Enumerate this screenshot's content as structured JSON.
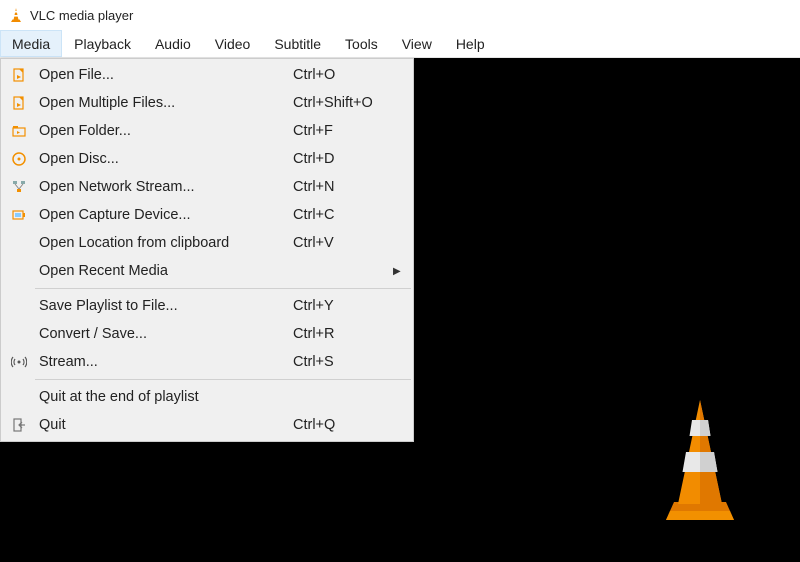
{
  "window": {
    "title": "VLC media player"
  },
  "menubar": [
    {
      "label": "Media",
      "active": true
    },
    {
      "label": "Playback"
    },
    {
      "label": "Audio"
    },
    {
      "label": "Video"
    },
    {
      "label": "Subtitle"
    },
    {
      "label": "Tools"
    },
    {
      "label": "View"
    },
    {
      "label": "Help"
    }
  ],
  "media_menu": {
    "groups": [
      [
        {
          "icon": "file-icon",
          "label": "Open File...",
          "shortcut": "Ctrl+O"
        },
        {
          "icon": "file-icon",
          "label": "Open Multiple Files...",
          "shortcut": "Ctrl+Shift+O"
        },
        {
          "icon": "folder-icon",
          "label": "Open Folder...",
          "shortcut": "Ctrl+F"
        },
        {
          "icon": "disc-icon",
          "label": "Open Disc...",
          "shortcut": "Ctrl+D"
        },
        {
          "icon": "network-icon",
          "label": "Open Network Stream...",
          "shortcut": "Ctrl+N"
        },
        {
          "icon": "capture-icon",
          "label": "Open Capture Device...",
          "shortcut": "Ctrl+C"
        },
        {
          "icon": "",
          "label": "Open Location from clipboard",
          "shortcut": "Ctrl+V"
        },
        {
          "icon": "",
          "label": "Open Recent Media",
          "shortcut": "",
          "submenu": true
        }
      ],
      [
        {
          "icon": "",
          "label": "Save Playlist to File...",
          "shortcut": "Ctrl+Y"
        },
        {
          "icon": "",
          "label": "Convert / Save...",
          "shortcut": "Ctrl+R"
        },
        {
          "icon": "stream-icon",
          "label": "Stream...",
          "shortcut": "Ctrl+S"
        }
      ],
      [
        {
          "icon": "",
          "label": "Quit at the end of playlist",
          "shortcut": ""
        },
        {
          "icon": "quit-icon",
          "label": "Quit",
          "shortcut": "Ctrl+Q"
        }
      ]
    ]
  }
}
